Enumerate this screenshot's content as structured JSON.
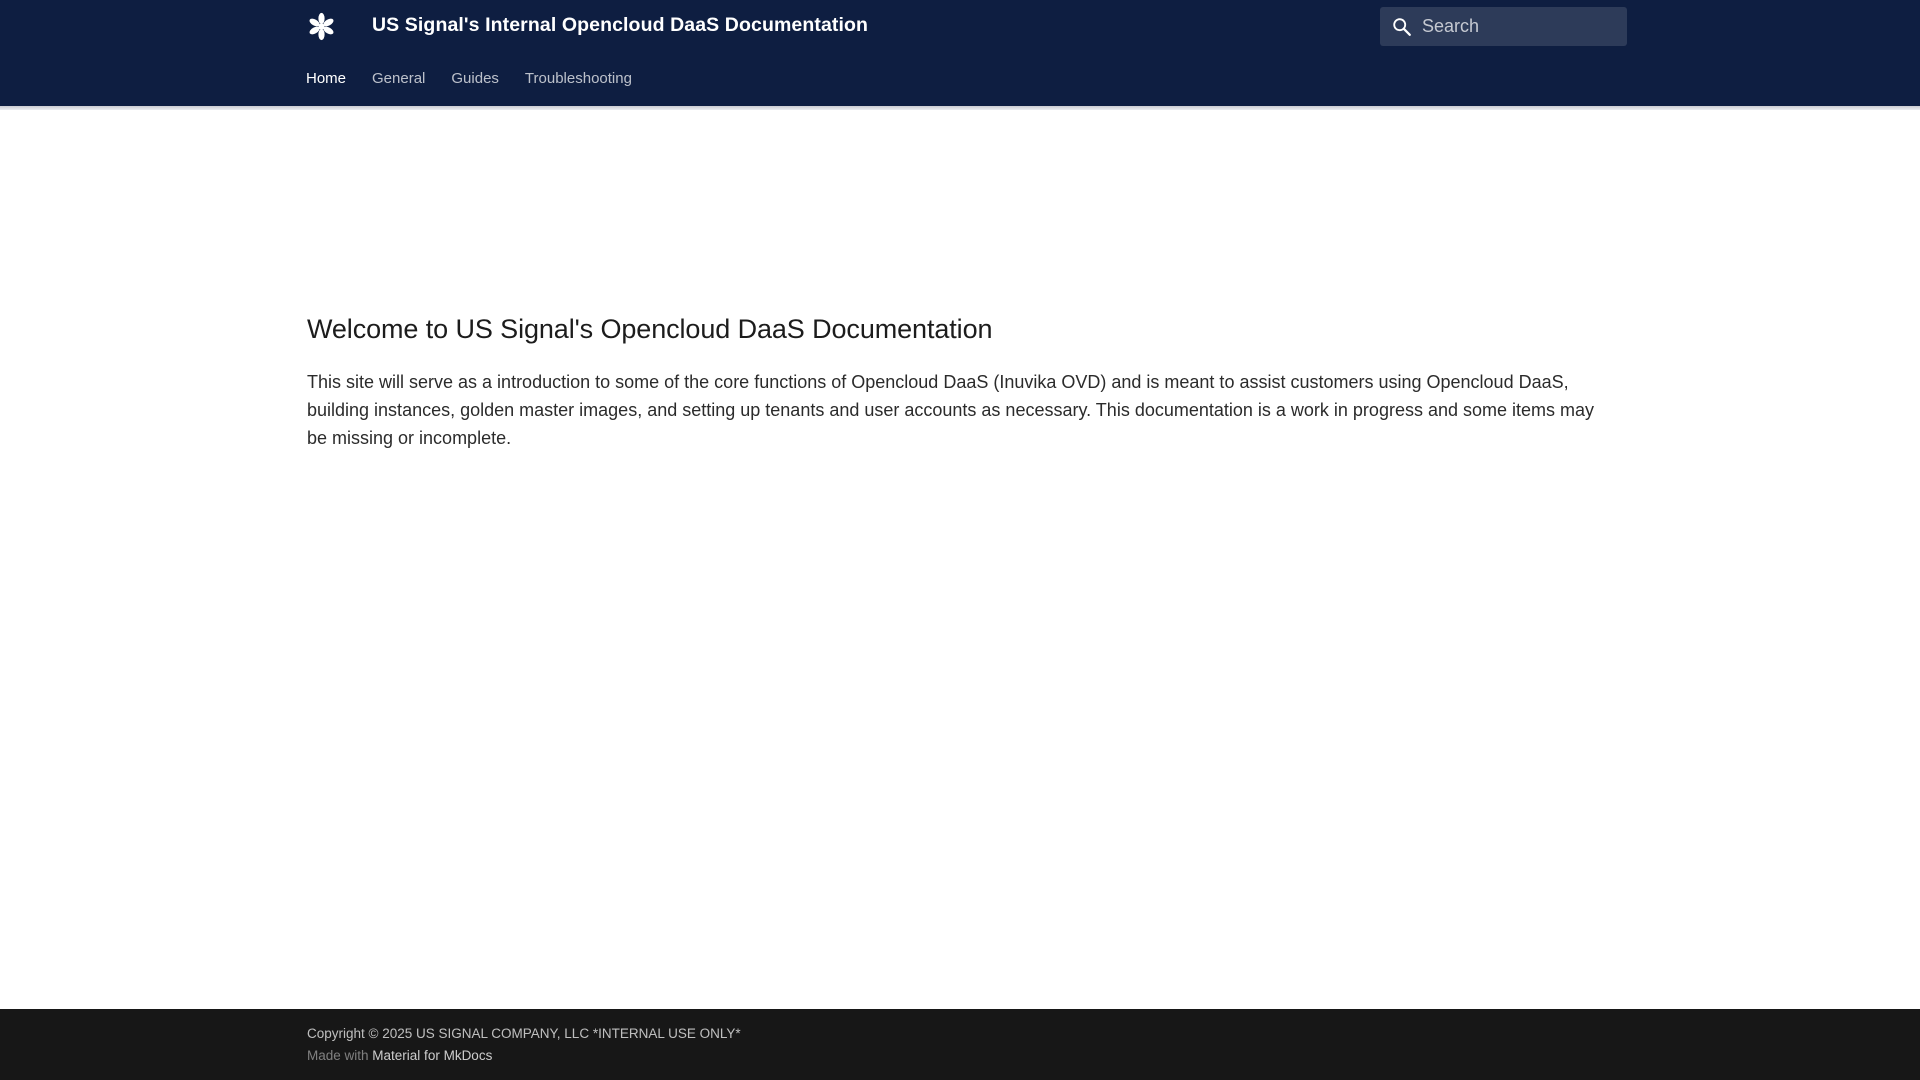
{
  "header": {
    "site_title": "US Signal's Internal Opencloud DaaS Documentation",
    "logo_icon": "asterisk-logo-icon",
    "background_color": "#0e1e41"
  },
  "search": {
    "placeholder": "Search",
    "icon": "search-icon"
  },
  "tabs": [
    {
      "label": "Home",
      "active": true
    },
    {
      "label": "General",
      "active": false
    },
    {
      "label": "Guides",
      "active": false
    },
    {
      "label": "Troubleshooting",
      "active": false
    }
  ],
  "content": {
    "title": "Welcome to US Signal's Opencloud DaaS Documentation",
    "intro": "This site will serve as a introduction to some of the core functions of Opencloud DaaS (Inuvika OVD) and is meant to assist customers using Opencloud DaaS, building instances, golden master images, and setting up tenants and user accounts as necessary. This documentation is a work in progress and some items may be missing or incomplete."
  },
  "footer": {
    "copyright": "Copyright © 2025 US SIGNAL COMPANY, LLC *INTERNAL USE ONLY*",
    "made_with_prefix": "Made with",
    "made_with_link": "Material for MkDocs",
    "background_color": "#171717"
  }
}
